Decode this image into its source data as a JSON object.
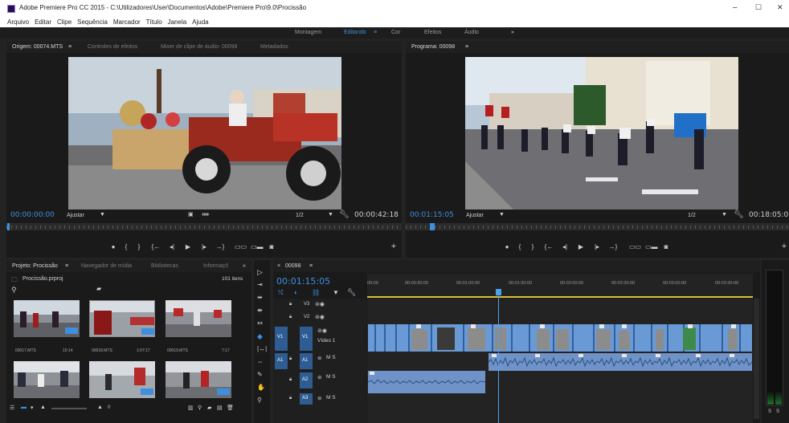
{
  "app": {
    "title": "Adobe Premiere Pro CC 2015 - C:\\Utilizadores\\User\\Documentos\\Adobe\\Premiere Pro\\9.0\\Procissão",
    "window_controls": [
      "–",
      "☐",
      "✕"
    ]
  },
  "menu": [
    "Arquivo",
    "Editar",
    "Clipe",
    "Sequência",
    "Marcador",
    "Título",
    "Janela",
    "Ajuda"
  ],
  "workspaces": {
    "items": [
      "Montagem",
      "Editando",
      "Cor",
      "Efeitos",
      "Áudio"
    ],
    "active": "Editando",
    "more": "»"
  },
  "source": {
    "tabs": [
      "Origem: 00074.MTS",
      "Controles de efeitos",
      "Mixer de clipe de áudio: 00098",
      "Metadados"
    ],
    "timecode_in": "00:00:00:00",
    "zoom": "Ajustar",
    "resolution": "1/2",
    "timecode_duration": "00:00:42:18"
  },
  "program": {
    "tab": "Programa: 00098",
    "timecode": "00:01:15:05",
    "zoom": "Ajustar",
    "resolution": "1/2",
    "timecode_duration": "00:18:05:0"
  },
  "project": {
    "tabs": [
      "Projeto: Procissão",
      "Navegador de mídia",
      "Bibliotecas",
      "Informaçõ"
    ],
    "more": "»",
    "file": "Procissão.prproj",
    "item_count": "101 itens",
    "thumbnails": [
      {
        "name": "00017.MTS",
        "duration": "10:14"
      },
      {
        "name": "00018.MTS",
        "duration": "1:07:17"
      },
      {
        "name": "00019.MTS",
        "duration": "7:17"
      },
      {
        "name": "",
        "duration": ""
      },
      {
        "name": "",
        "duration": ""
      },
      {
        "name": "",
        "duration": ""
      }
    ]
  },
  "timeline": {
    "tab": "00098",
    "timecode": "00:01:15:05",
    "ruler": [
      "00:00",
      "00:00:30:00",
      "00:01:00:00",
      "00:01:30:00",
      "00:02:00:00",
      "00:02:30:00",
      "00:03:00:00",
      "00:03:30:00"
    ],
    "tracks": [
      {
        "name": "V3",
        "type": "video"
      },
      {
        "name": "V2",
        "type": "video"
      },
      {
        "name": "V1",
        "type": "video",
        "label": "Vídeo 1"
      },
      {
        "name": "A1",
        "type": "audio"
      },
      {
        "name": "A2",
        "type": "audio"
      },
      {
        "name": "A3",
        "type": "audio"
      }
    ],
    "audio_flags": "M  S"
  },
  "meter": {
    "labels": [
      "S",
      "S"
    ]
  },
  "colors": {
    "accent": "#3e8fe0",
    "video_clip": "#6a9ad6",
    "audio_clip": "#6f93c9",
    "playhead": "#4aa3e8"
  },
  "icons": {
    "app": "premiere-icon",
    "folder": "folder-icon",
    "search": "search-icon",
    "wrench": "wrench-icon",
    "play": "play-icon",
    "camera": "camera-icon",
    "add": "add-icon"
  }
}
